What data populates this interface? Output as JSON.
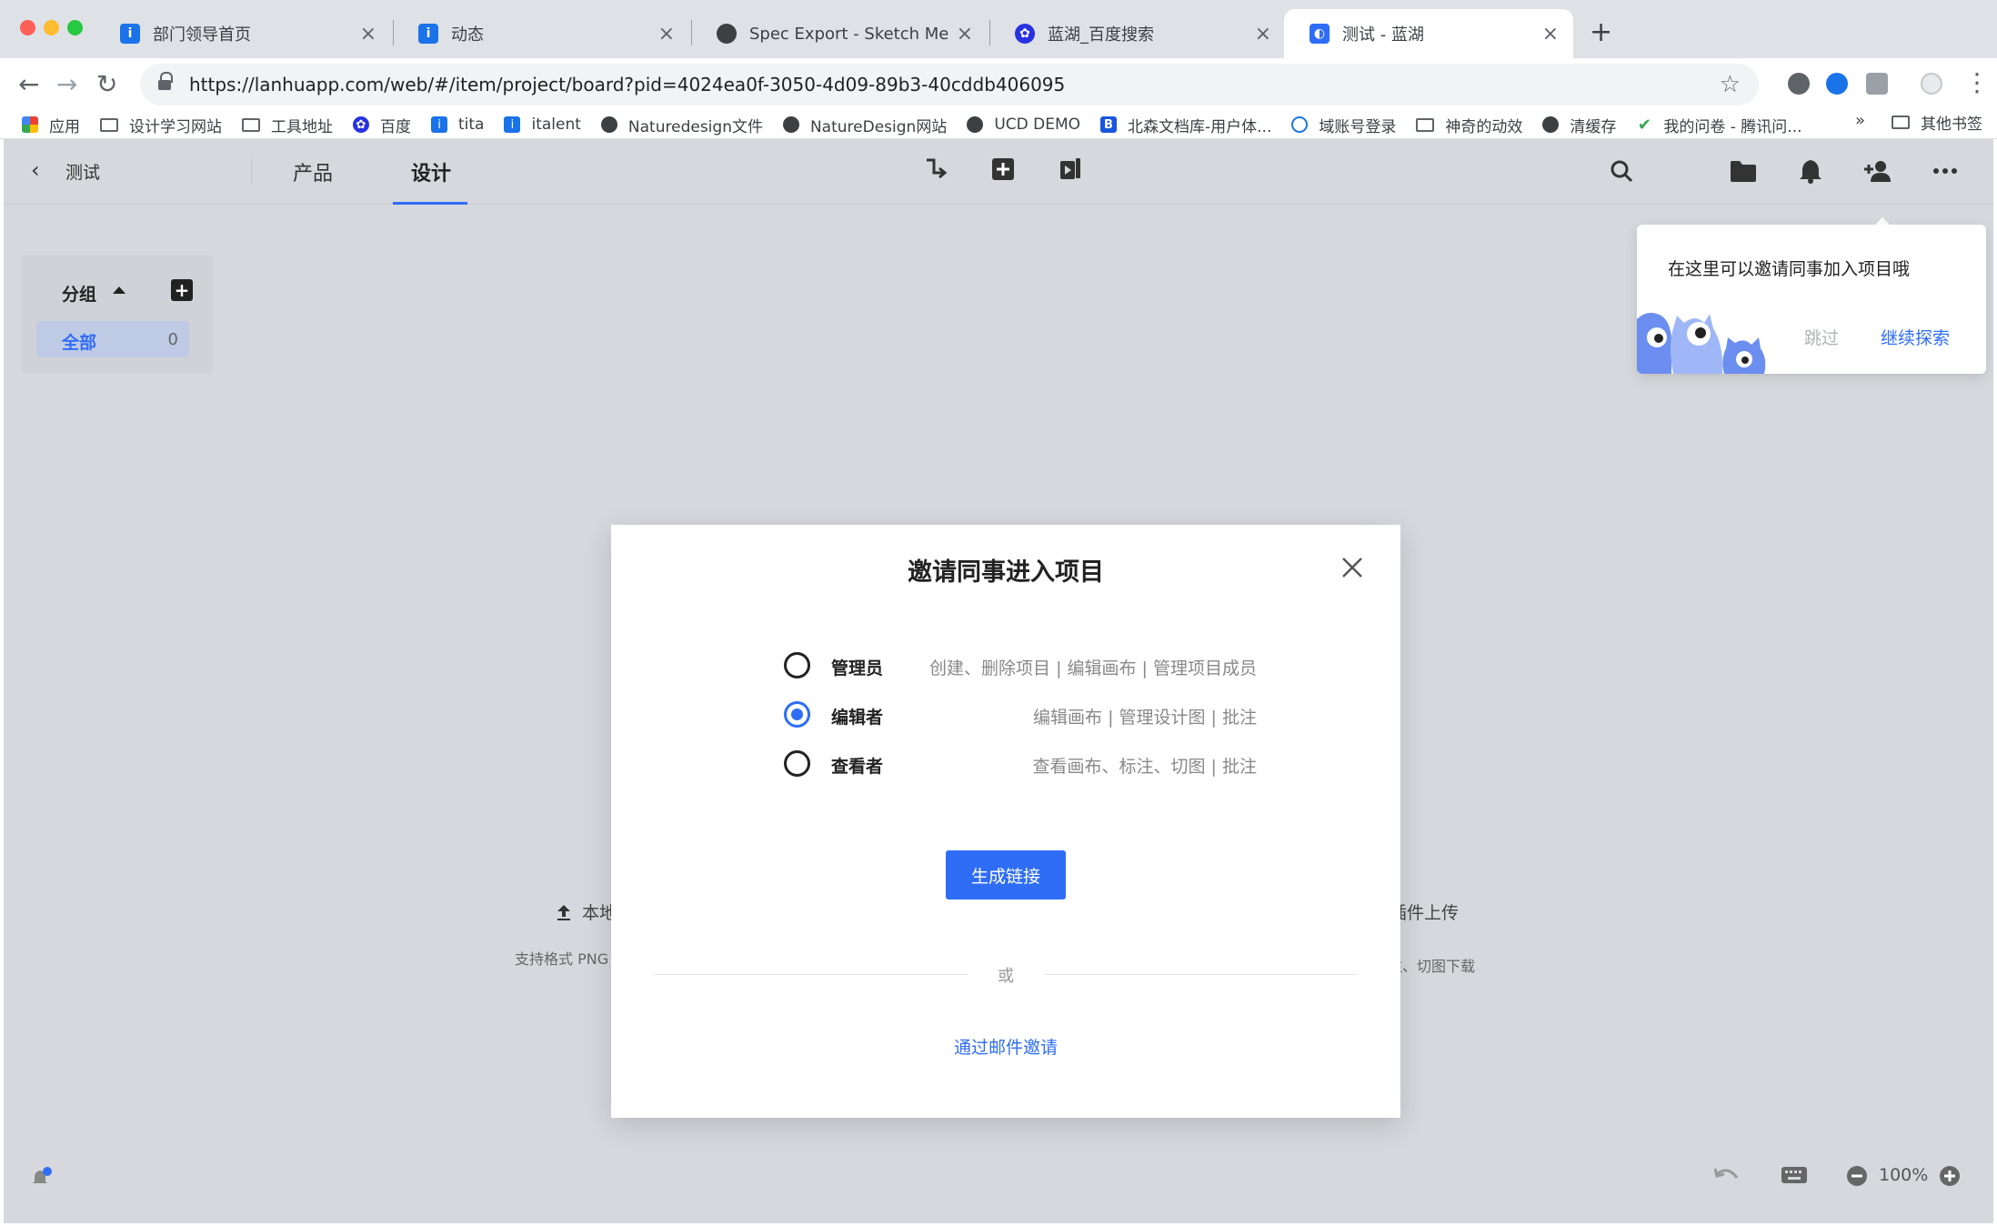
{
  "browser": {
    "tabs": [
      {
        "title": "部门领导首页",
        "icon": "info-icon",
        "color": "#1a73e8"
      },
      {
        "title": "动态",
        "icon": "info-icon",
        "color": "#1a73e8"
      },
      {
        "title": "Spec Export - Sketch Measure",
        "icon": "globe-icon",
        "color": "#3c4043"
      },
      {
        "title": "蓝湖_百度搜索",
        "icon": "baidu-paw-icon",
        "color": "#2932e1"
      },
      {
        "title": "测试 - 蓝湖",
        "icon": "lanhu-icon",
        "color": "#2f6df6"
      }
    ],
    "url": "https://lanhuapp.com/web/#/item/project/board?pid=4024ea0f-3050-4d09-89b3-40cddb406095",
    "bookmarks": [
      {
        "label": "应用",
        "icon": "apps-grid-icon"
      },
      {
        "label": "设计学习网站",
        "icon": "folder-icon"
      },
      {
        "label": "工具地址",
        "icon": "folder-icon"
      },
      {
        "label": "百度",
        "icon": "baidu-paw-icon"
      },
      {
        "label": "tita",
        "icon": "info-icon"
      },
      {
        "label": "italent",
        "icon": "info-icon"
      },
      {
        "label": "Naturedesign文件",
        "icon": "globe-icon"
      },
      {
        "label": "NatureDesign网站",
        "icon": "globe-icon"
      },
      {
        "label": "UCD DEMO",
        "icon": "globe-icon"
      },
      {
        "label": "北森文档库-用户体...",
        "icon": "b-icon"
      },
      {
        "label": "域账号登录",
        "icon": "compass-icon"
      },
      {
        "label": "神奇的动效",
        "icon": "folder-icon"
      },
      {
        "label": "清缓存",
        "icon": "globe-icon"
      },
      {
        "label": "我的问卷 - 腾讯问...",
        "icon": "check-icon"
      }
    ],
    "bookmarks_more": "»",
    "other_bookmarks": "其他书签"
  },
  "app": {
    "back_label": "‹",
    "project_name": "测试",
    "nav_tabs": [
      "产品",
      "设计"
    ],
    "active_tab": "设计",
    "accent_color": "#2f6df6",
    "groups": {
      "title": "分组",
      "add_label": "+",
      "items": [
        {
          "label": "全部",
          "count": "0"
        }
      ]
    },
    "upload": {
      "left_label": "本地",
      "left_sub": "支持格式 PNG",
      "right_label": "插件上传",
      "right_sub": "注、切图下载"
    },
    "zoom": "100%"
  },
  "tooltip": {
    "text": "在这里可以邀请同事加入项目哦",
    "skip": "跳过",
    "continue": "继续探索"
  },
  "modal": {
    "title": "邀请同事进入项目",
    "roles": [
      {
        "name": "管理员",
        "desc": "创建、删除项目 | 编辑画布 | 管理项目成员",
        "checked": false
      },
      {
        "name": "编辑者",
        "desc": "编辑画布 | 管理设计图 | 批注",
        "checked": true
      },
      {
        "name": "查看者",
        "desc": "查看画布、标注、切图 | 批注",
        "checked": false
      }
    ],
    "generate_button": "生成链接",
    "or_text": "或",
    "email_invite": "通过邮件邀请"
  }
}
